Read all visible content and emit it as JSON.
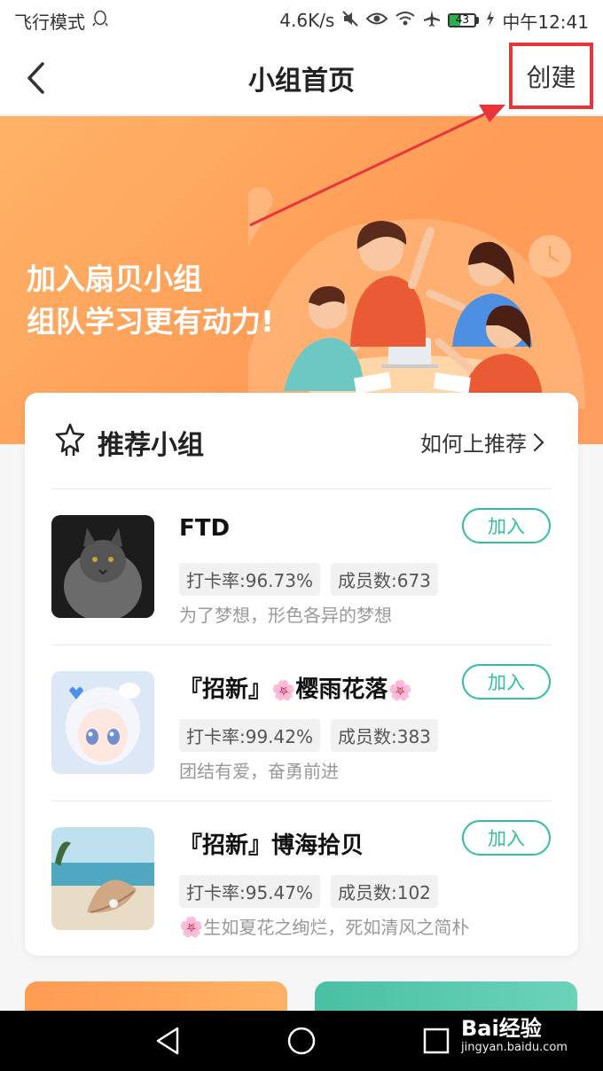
{
  "status_bar": {
    "left_text": "飞行模式",
    "speed": "4.6K/s",
    "battery_level": "43",
    "time": "中午12:41"
  },
  "nav": {
    "title": "小组首页",
    "create_label": "创建"
  },
  "banner": {
    "slogan_line1": "加入扇贝小组",
    "slogan_line2": "组队学习更有动力!"
  },
  "recommend": {
    "title": "推荐小组",
    "how_label": "如何上推荐",
    "groups": [
      {
        "name": "FTD",
        "name_prefix": "",
        "name_suffix": "",
        "checkin": "打卡率:96.73%",
        "members": "成员数:673",
        "desc": "为了梦想，形色各异的梦想",
        "join_label": "加入",
        "avatar": "cat-avatar"
      },
      {
        "name_prefix": "『招新』",
        "name": "樱雨花落",
        "name_suffix": "",
        "checkin": "打卡率:99.42%",
        "members": "成员数:383",
        "desc": "团结有爱，奋勇前进",
        "join_label": "加入",
        "avatar": "anime-girl-avatar"
      },
      {
        "name_prefix": "『招新』",
        "name": "博海拾贝",
        "name_suffix": "",
        "checkin": "打卡率:95.47%",
        "members": "成员数:102",
        "desc": "生如夏花之绚烂，死如清风之简朴",
        "join_label": "加入",
        "avatar": "shell-beach-avatar"
      }
    ]
  },
  "watermark": {
    "brand": "Bai经验",
    "url": "jingyan.baidu.com"
  },
  "colors": {
    "accent_teal": "#2fbea3",
    "banner_orange": "#ff9b57",
    "highlight_red": "#e8353a"
  }
}
